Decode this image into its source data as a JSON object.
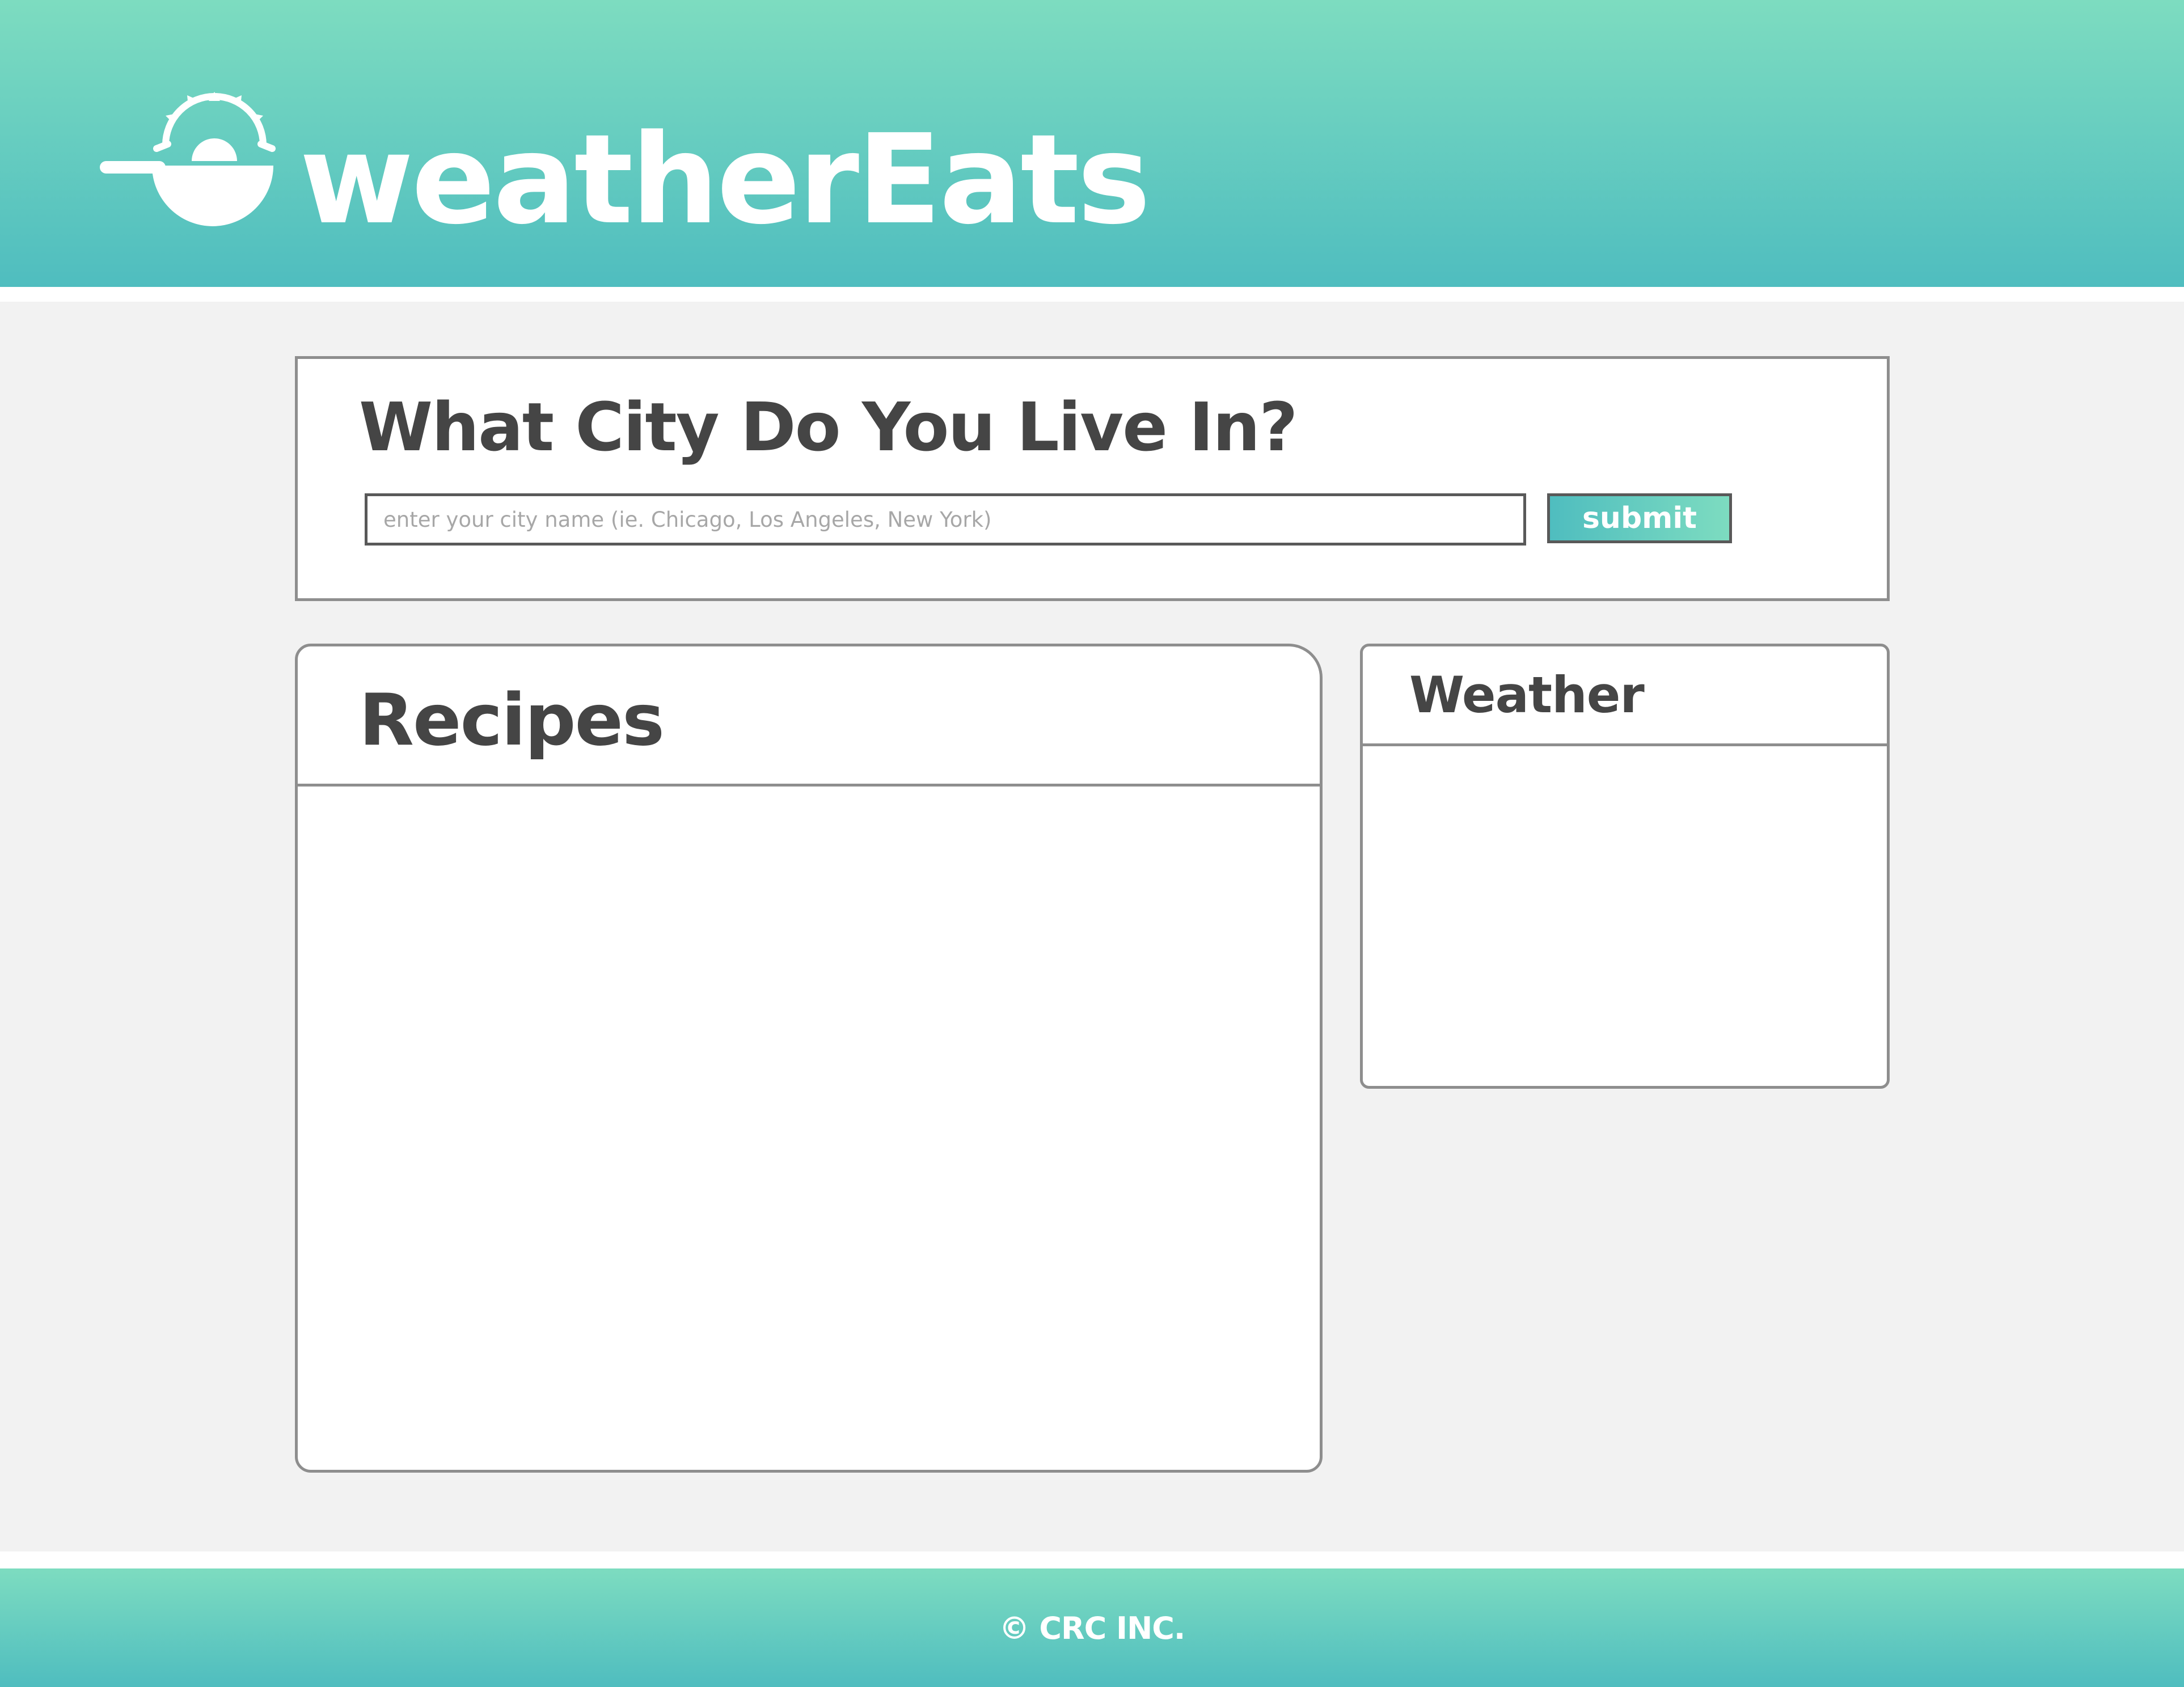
{
  "header": {
    "brand": "weatherEats",
    "logo_icon": "bowl-with-sun-icon"
  },
  "city_search": {
    "title": "What City Do You Live In?",
    "input_placeholder": "enter your city name (ie. Chicago, Los Angeles, New York)",
    "input_value": "",
    "submit_label": "submit"
  },
  "recipes": {
    "title": "Recipes"
  },
  "weather": {
    "title": "Weather"
  },
  "footer": {
    "copyright": "© CRC INC."
  },
  "colors": {
    "accent_light": "#7ddcc0",
    "accent_dark": "#4fbdbf",
    "background": "#f2f2f2",
    "heading_text": "#454545",
    "card_border": "#8e8e8e"
  }
}
